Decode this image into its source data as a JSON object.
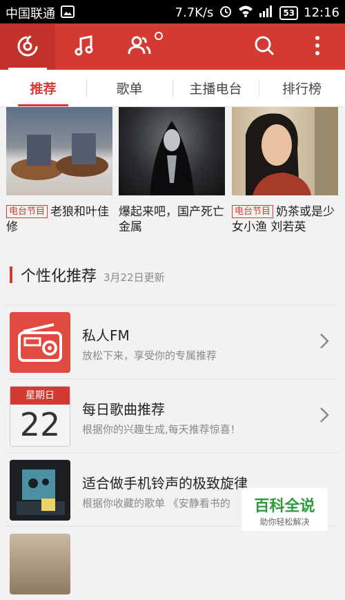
{
  "statusbar": {
    "carrier": "中国联通",
    "speed": "7.7K/s",
    "battery": "53",
    "time": "12:16"
  },
  "appbar": {
    "logo_icon": "netease-logo-icon",
    "music_icon": "music-note-icon",
    "friends_icon": "friends-icon",
    "search_icon": "search-icon",
    "more_icon": "more-vertical-icon"
  },
  "tabs": [
    {
      "label": "推荐"
    },
    {
      "label": "歌单"
    },
    {
      "label": "主播电台"
    },
    {
      "label": "排行榜"
    }
  ],
  "radio_cards": [
    {
      "tag": "电台节目",
      "text": "老狼和叶佳修"
    },
    {
      "tag": "",
      "text": "爆起来吧，国产死亡金属"
    },
    {
      "tag": "电台节目",
      "text": "奶茶或是少女小渔 刘若英"
    }
  ],
  "personalized": {
    "title": "个性化推荐",
    "date": "3月22日更新"
  },
  "list": [
    {
      "title": "私人FM",
      "subtitle": "放松下来，享受你的专属推荐"
    },
    {
      "title": "每日歌曲推荐",
      "subtitle": "根据你的兴趣生成,每天推荐惊喜！",
      "cal_weekday": "星期日",
      "cal_day": "22"
    },
    {
      "title": "适合做手机铃声的极致旋律",
      "subtitle": "根据你收藏的歌单 《安静看书的"
    }
  ],
  "watermark": {
    "line1": "百科全说",
    "line2": "助你轻松解决"
  },
  "colors": {
    "accent": "#d33a31",
    "background": "#f2f2f2"
  }
}
